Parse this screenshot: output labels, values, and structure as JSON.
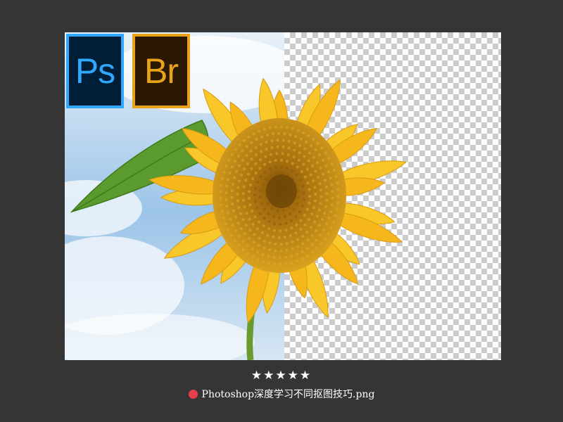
{
  "window": {
    "background": "#353535"
  },
  "preview": {
    "image_description_icon": "sunflower-image",
    "checker_light": "#ffffff",
    "checker_dark": "#cccccc",
    "sky_color": "#9cc4e8",
    "petal_color": "#f6b71c",
    "center_color": "#b57d10",
    "leaf_color": "#5b9a2e"
  },
  "badges": {
    "ps": {
      "text": "Ps",
      "text_color": "#31a8ff",
      "bg": "#001e36"
    },
    "br": {
      "text": "Br",
      "text_color": "#e8a318",
      "bg": "#2b1800"
    }
  },
  "item": {
    "rating": "★★★★★",
    "rating_value": 5,
    "label_color": "#e8404a",
    "filename": "Photoshop深度学习不同抠图技巧.png"
  }
}
